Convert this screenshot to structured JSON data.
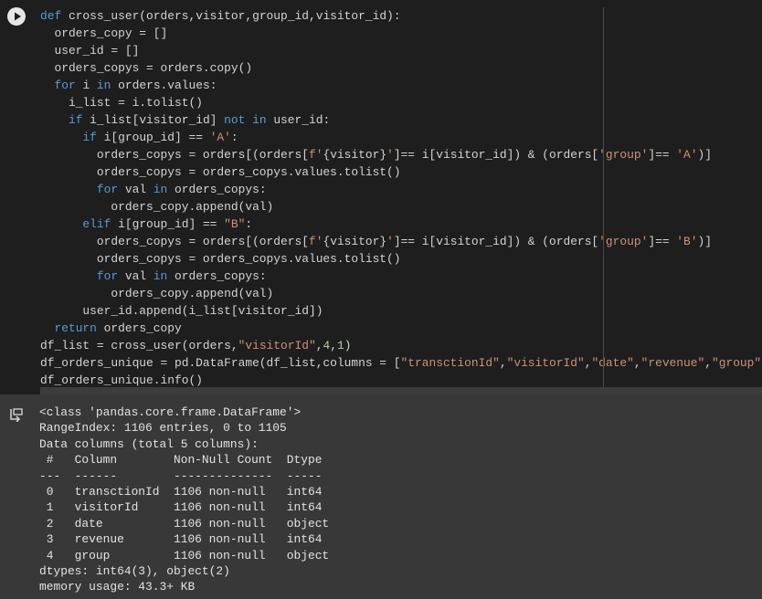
{
  "cell": {
    "run_button_icon": "play-icon",
    "output_icon": "output-arrow-icon",
    "code_lines": [
      [
        {
          "t": "def",
          "c": "kw"
        },
        {
          "t": " cross_user(orders,visitor,group_id,visitor_id):"
        }
      ],
      [
        {
          "t": "  orders_copy = []"
        }
      ],
      [
        {
          "t": "  user_id = []"
        }
      ],
      [
        {
          "t": "  orders_copys = orders.copy()"
        }
      ],
      [
        {
          "t": "  "
        },
        {
          "t": "for",
          "c": "kw"
        },
        {
          "t": " i "
        },
        {
          "t": "in",
          "c": "kw"
        },
        {
          "t": " orders.values:"
        }
      ],
      [
        {
          "t": "    i_list = i.tolist()"
        }
      ],
      [
        {
          "t": "    "
        },
        {
          "t": "if",
          "c": "kw"
        },
        {
          "t": " i_list[visitor_id] "
        },
        {
          "t": "not in",
          "c": "kw"
        },
        {
          "t": " user_id:"
        }
      ],
      [
        {
          "t": "      "
        },
        {
          "t": "if",
          "c": "kw"
        },
        {
          "t": " i[group_id] == "
        },
        {
          "t": "'A'",
          "c": "str"
        },
        {
          "t": ":"
        }
      ],
      [
        {
          "t": "        orders_copys = orders[(orders["
        },
        {
          "t": "f'",
          "c": "str"
        },
        {
          "t": "{visitor}"
        },
        {
          "t": "'",
          "c": "str"
        },
        {
          "t": "]== i[visitor_id]) & (orders["
        },
        {
          "t": "'group'",
          "c": "str"
        },
        {
          "t": "]== "
        },
        {
          "t": "'A'",
          "c": "str"
        },
        {
          "t": ")]"
        }
      ],
      [
        {
          "t": "        orders_copys = orders_copys.values.tolist()"
        }
      ],
      [
        {
          "t": "        "
        },
        {
          "t": "for",
          "c": "kw"
        },
        {
          "t": " val "
        },
        {
          "t": "in",
          "c": "kw"
        },
        {
          "t": " orders_copys:"
        }
      ],
      [
        {
          "t": "          orders_copy.append(val)"
        }
      ],
      [
        {
          "t": "      "
        },
        {
          "t": "elif",
          "c": "kw"
        },
        {
          "t": " i[group_id] == "
        },
        {
          "t": "\"B\"",
          "c": "str"
        },
        {
          "t": ":"
        }
      ],
      [
        {
          "t": "        orders_copys = orders[(orders["
        },
        {
          "t": "f'",
          "c": "str"
        },
        {
          "t": "{visitor}"
        },
        {
          "t": "'",
          "c": "str"
        },
        {
          "t": "]== i[visitor_id]) & (orders["
        },
        {
          "t": "'group'",
          "c": "str"
        },
        {
          "t": "]== "
        },
        {
          "t": "'B'",
          "c": "str"
        },
        {
          "t": ")]"
        }
      ],
      [
        {
          "t": "        orders_copys = orders_copys.values.tolist()"
        }
      ],
      [
        {
          "t": "        "
        },
        {
          "t": "for",
          "c": "kw"
        },
        {
          "t": " val "
        },
        {
          "t": "in",
          "c": "kw"
        },
        {
          "t": " orders_copys:"
        }
      ],
      [
        {
          "t": "          orders_copy.append(val)"
        }
      ],
      [
        {
          "t": "      user_id.append(i_list[visitor_id])"
        }
      ],
      [
        {
          "t": "  "
        },
        {
          "t": "return",
          "c": "kw"
        },
        {
          "t": " orders_copy"
        }
      ],
      [
        {
          "t": "df_list = cross_user(orders,"
        },
        {
          "t": "\"visitorId\"",
          "c": "str"
        },
        {
          "t": ","
        },
        {
          "t": "4",
          "c": "num"
        },
        {
          "t": ","
        },
        {
          "t": "1",
          "c": "num"
        },
        {
          "t": ")"
        }
      ],
      [
        {
          "t": "df_orders_unique = pd.DataFrame(df_list,columns = ["
        },
        {
          "t": "\"transctionId\"",
          "c": "str"
        },
        {
          "t": ","
        },
        {
          "t": "\"visitorId\"",
          "c": "str"
        },
        {
          "t": ","
        },
        {
          "t": "\"date\"",
          "c": "str"
        },
        {
          "t": ","
        },
        {
          "t": "\"revenue\"",
          "c": "str"
        },
        {
          "t": ","
        },
        {
          "t": "\"group\"",
          "c": "str"
        },
        {
          "t": "]"
        }
      ],
      [
        {
          "t": "df_orders_unique.info()"
        }
      ]
    ]
  },
  "output": {
    "lines": [
      "<class 'pandas.core.frame.DataFrame'>",
      "RangeIndex: 1106 entries, 0 to 1105",
      "Data columns (total 5 columns):",
      " #   Column        Non-Null Count  Dtype ",
      "---  ------        --------------  ----- ",
      " 0   transctionId  1106 non-null   int64 ",
      " 1   visitorId     1106 non-null   int64 ",
      " 2   date          1106 non-null   object",
      " 3   revenue       1106 non-null   int64 ",
      " 4   group         1106 non-null   object",
      "dtypes: int64(3), object(2)",
      "memory usage: 43.3+ KB"
    ]
  }
}
